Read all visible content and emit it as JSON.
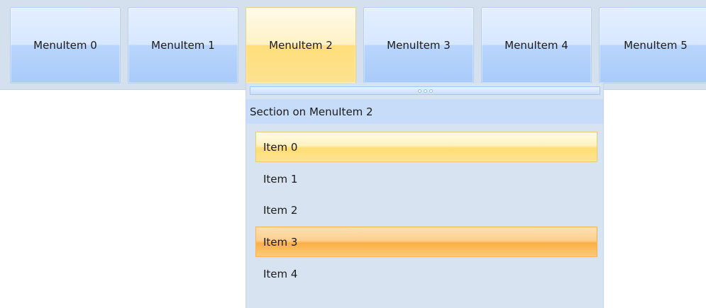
{
  "menubar": {
    "items": [
      {
        "label": "MenuItem 0"
      },
      {
        "label": "MenuItem 1"
      },
      {
        "label": "MenuItem 2"
      },
      {
        "label": "MenuItem 3"
      },
      {
        "label": "MenuItem 4"
      },
      {
        "label": "MenuItem 5"
      }
    ],
    "active_index": 2
  },
  "dropdown": {
    "section_header": "Section on MenuItem 2",
    "items": [
      {
        "label": "Item 0",
        "state": "hover"
      },
      {
        "label": "Item 1",
        "state": "normal"
      },
      {
        "label": "Item 2",
        "state": "normal"
      },
      {
        "label": "Item 3",
        "state": "selected"
      },
      {
        "label": "Item 4",
        "state": "normal"
      }
    ]
  },
  "colors": {
    "menubar_background": "#d4e0ee",
    "menuitem_blue": "#b9d5fc",
    "menuitem_active_gold": "#ffdf7c",
    "panel_background": "#d7e3f1",
    "section_header_background": "#c6dcf9",
    "item_hover_gold": "#ffdd72",
    "item_selected_orange": "#fbb045"
  },
  "icons": {
    "resize_grip": "resize-grip-icon"
  }
}
